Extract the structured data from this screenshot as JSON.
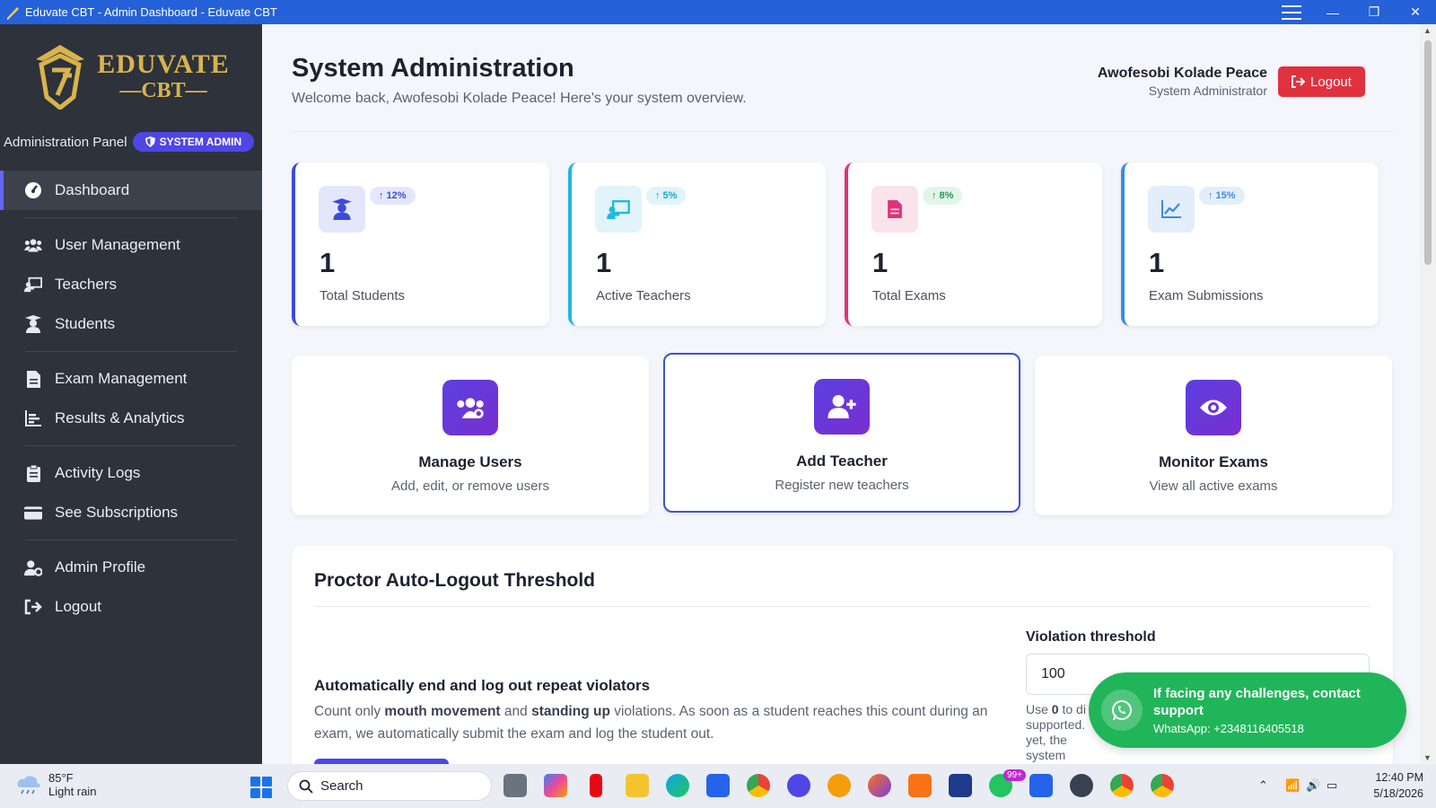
{
  "window": {
    "title": "Eduvate CBT - Admin Dashboard - Eduvate CBT"
  },
  "brand": {
    "line1": "EDUVATE",
    "line2": "CBT"
  },
  "sidebar": {
    "panel_label": "Administration Panel",
    "role_badge": "SYSTEM ADMIN",
    "items": [
      {
        "label": "Dashboard",
        "icon": "gauge-icon"
      },
      {
        "label": "User Management",
        "icon": "users-icon"
      },
      {
        "label": "Teachers",
        "icon": "chalkboard-teacher-icon"
      },
      {
        "label": "Students",
        "icon": "graduate-icon"
      },
      {
        "label": "Exam Management",
        "icon": "file-icon"
      },
      {
        "label": "Results & Analytics",
        "icon": "bar-chart-icon"
      },
      {
        "label": "Activity Logs",
        "icon": "clipboard-icon"
      },
      {
        "label": "See Subscriptions",
        "icon": "credit-card-icon"
      },
      {
        "label": "Admin Profile",
        "icon": "user-gear-icon"
      },
      {
        "label": "Logout",
        "icon": "logout-icon"
      }
    ]
  },
  "header": {
    "title": "System Administration",
    "subtitle": "Welcome back, Awofesobi Kolade Peace! Here's your system overview.",
    "user_name": "Awofesobi Kolade Peace",
    "user_role": "System Administrator",
    "logout_label": "Logout"
  },
  "stats": [
    {
      "value": "1",
      "label": "Total Students",
      "trend": "12%",
      "color": "#3b4cdb"
    },
    {
      "value": "1",
      "label": "Active Teachers",
      "trend": "5%",
      "color": "#22b8e0"
    },
    {
      "value": "1",
      "label": "Total Exams",
      "trend": "8%",
      "color": "#e0337a"
    },
    {
      "value": "1",
      "label": "Exam Submissions",
      "trend": "15%",
      "color": "#3a8be8"
    }
  ],
  "actions": [
    {
      "title": "Manage Users",
      "desc": "Add, edit, or remove users"
    },
    {
      "title": "Add Teacher",
      "desc": "Register new teachers"
    },
    {
      "title": "Monitor Exams",
      "desc": "View all active exams"
    }
  ],
  "proctor": {
    "title": "Proctor Auto-Logout Threshold",
    "subtitle": "Automatically end and log out repeat violators",
    "desc_pre": "Count only ",
    "desc_b1": "mouth movement",
    "desc_mid": " and ",
    "desc_b2": "standing up",
    "desc_post": " violations. As soon as a student reaches this count during an exam, we automatically submit the exam and log the student out.",
    "threshold_label": "Violation threshold",
    "threshold_value": "100",
    "help_pre": "Use ",
    "help_b": "0",
    "help_post": " to di supported. yet, the system"
  },
  "support": {
    "title": "If facing any challenges, contact support",
    "whatsapp": "WhatsApp: +2348116405518"
  },
  "taskbar": {
    "temp": "85°F",
    "weather": "Light rain",
    "search_placeholder": "Search",
    "badge": "99+",
    "time": "12:40 PM",
    "date": "5/18/2026"
  }
}
